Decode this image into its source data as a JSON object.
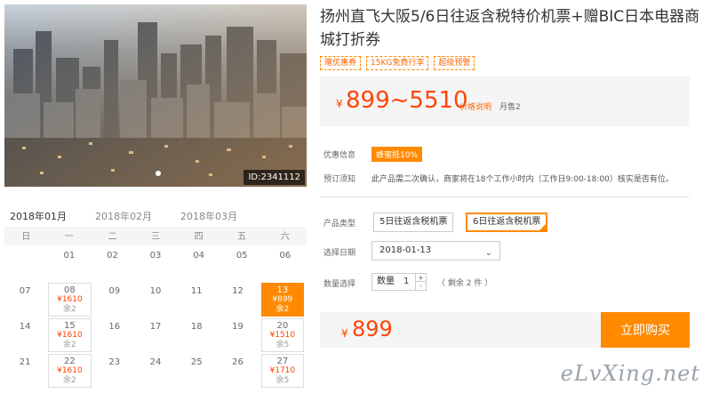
{
  "hero": {
    "photo_id": "ID:2341112"
  },
  "calendar": {
    "months": [
      "2018年01月",
      "2018年02月",
      "2018年03月"
    ],
    "weekdays": [
      "日",
      "一",
      "二",
      "三",
      "四",
      "五",
      "六"
    ]
  },
  "product": {
    "title": "扬州直飞大阪5/6日往返含税特价机票+赠BIC日本电器商城打折券",
    "tags": [
      "赠优惠券",
      "15KG免费行李",
      "超级预警"
    ],
    "currency_symbol": "¥",
    "price_range": "899~5510",
    "price_note": "价格说明",
    "monthly_sales": "月售2",
    "promo_label": "优惠信息",
    "promo_badge": "蜂蜜抵10%",
    "notice_label": "预订须知",
    "notice_text": "此产品需二次确认，商家将在18个工作小时内（工作日9:00-18:00）核实是否有位。",
    "type_label": "产品类型",
    "type_options": [
      "5日往返含税机票",
      "6日往返含税机票"
    ],
    "date_label": "选择日期",
    "selected_date": "2018-01-13",
    "qty_label": "数量选择",
    "qty_text": "数量",
    "qty_value": "1",
    "remaining": "（ 剩余 2 件 ）",
    "total_price": "899",
    "buy_label": "立即购买"
  },
  "watermark": "eLvXing.net"
}
